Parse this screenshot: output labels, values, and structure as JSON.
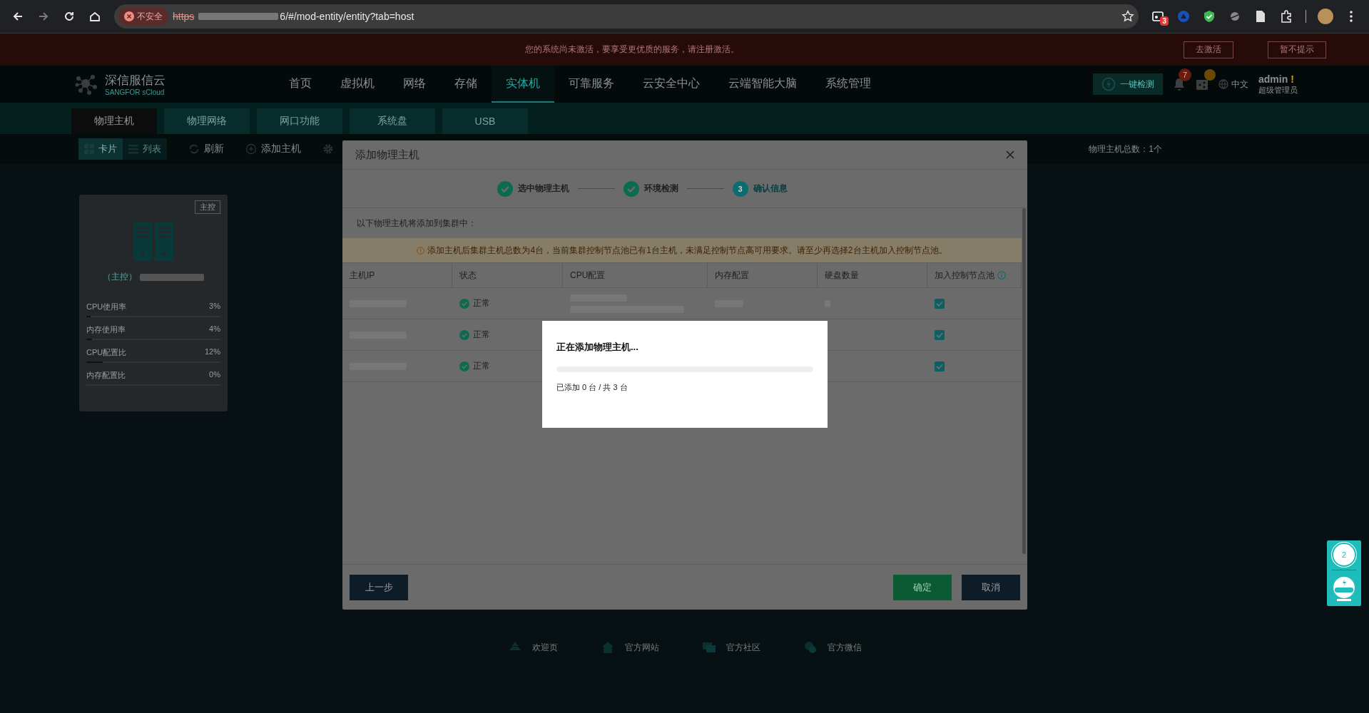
{
  "browser": {
    "security_label": "不安全",
    "url_scheme": "https",
    "url_rest": "6/#/mod-entity/entity?tab=host",
    "extension_badge": "3"
  },
  "banner": {
    "message": "您的系统尚未激活，要享受更优质的服务，请注册激活。",
    "buttons": [
      "去激活",
      "暂不提示"
    ]
  },
  "header": {
    "logo_name": "深信服信云",
    "logo_sub": "SANGFOR sCloud",
    "nav": [
      {
        "label": "首页",
        "selected": false
      },
      {
        "label": "虚拟机",
        "selected": false
      },
      {
        "label": "网络",
        "selected": false
      },
      {
        "label": "存储",
        "selected": false
      },
      {
        "label": "实体机",
        "selected": true
      },
      {
        "label": "可靠服务",
        "selected": false
      },
      {
        "label": "云安全中心",
        "selected": false
      },
      {
        "label": "云端智能大脑",
        "selected": false
      },
      {
        "label": "系统管理",
        "selected": false
      }
    ],
    "check_button": "一键检测",
    "notification_count": "7",
    "language": "中文",
    "user": "admin",
    "user_flag": "!",
    "role": "超级管理员"
  },
  "subtabs": [
    {
      "label": "物理主机",
      "selected": true
    },
    {
      "label": "物理网络",
      "selected": false
    },
    {
      "label": "网口功能",
      "selected": false
    },
    {
      "label": "系统盘",
      "selected": false
    },
    {
      "label": "USB",
      "selected": false
    }
  ],
  "toolbar": {
    "views": [
      {
        "label": "卡片",
        "selected": true
      },
      {
        "label": "列表",
        "selected": false
      }
    ],
    "actions": [
      "刷新",
      "添加主机"
    ],
    "total": "物理主机总数：1个"
  },
  "host_card": {
    "tag": "主控",
    "name": "（主控）",
    "metrics": [
      {
        "label": "CPU使用率",
        "value": "3%",
        "level": 0.03
      },
      {
        "label": "内存使用率",
        "value": "4%",
        "level": 0.04
      },
      {
        "label": "CPU配置比",
        "value": "12%",
        "level": 0.12
      },
      {
        "label": "内存配置比",
        "value": "0%",
        "level": 0
      }
    ]
  },
  "dialog": {
    "title": "添加物理主机",
    "steps": [
      {
        "label": "选中物理主机",
        "completed": true,
        "selected": false
      },
      {
        "label": "环境检测",
        "completed": true,
        "selected": false
      },
      {
        "number": "3",
        "label": "确认信息",
        "completed": false,
        "selected": true
      }
    ],
    "intro": "以下物理主机将添加到集群中：",
    "warning": "添加主机后集群主机总数为4台，当前集群控制节点池已有1台主机，未满足控制节点高可用要求。请至少再选择2台主机加入控制节点池。",
    "columns": [
      "主机IP",
      "状态",
      "CPU配置",
      "内存配置",
      "硬盘数量",
      "加入控制节点池"
    ],
    "rows": [
      {
        "status": "正常",
        "join_pool": true
      },
      {
        "status": "正常",
        "join_pool": true
      },
      {
        "status": "正常",
        "join_pool": true
      }
    ],
    "back_button": "上一步",
    "ok_button": "确定",
    "cancel_button": "取消"
  },
  "loading": {
    "title": "正在添加物理主机...",
    "level": 0,
    "progress_text": "已添加 0 台 / 共 3 台"
  },
  "footer_links": [
    "欢迎页",
    "官方网站",
    "官方社区",
    "官方微信"
  ],
  "helper": {
    "count": "2"
  }
}
